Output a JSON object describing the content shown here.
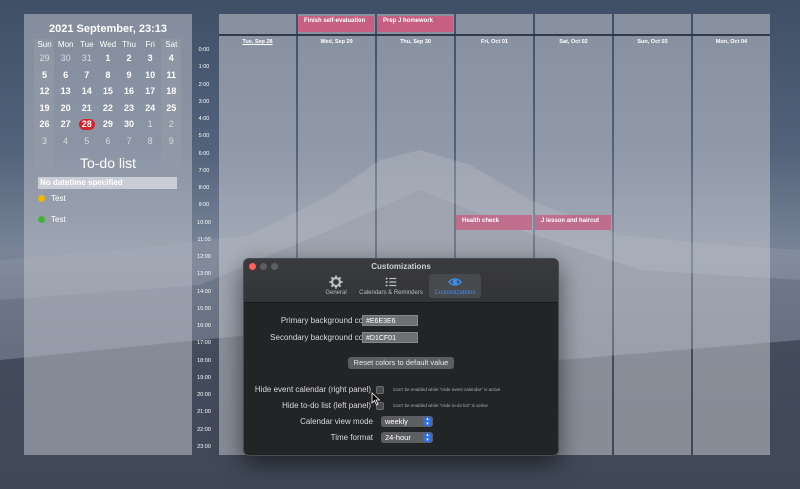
{
  "calendar": {
    "title": "2021 September, 23:13",
    "weekdays": [
      "Sun",
      "Mon",
      "Tue",
      "Wed",
      "Thu",
      "Fri",
      "Sat"
    ],
    "weeks": [
      [
        [
          "29",
          true
        ],
        [
          "30",
          true
        ],
        [
          "31",
          true
        ],
        [
          "1",
          false
        ],
        [
          "2",
          false
        ],
        [
          "3",
          false
        ],
        [
          "4",
          false
        ]
      ],
      [
        [
          "5",
          false
        ],
        [
          "6",
          false
        ],
        [
          "7",
          false
        ],
        [
          "8",
          false
        ],
        [
          "9",
          false
        ],
        [
          "10",
          false
        ],
        [
          "11",
          false
        ]
      ],
      [
        [
          "12",
          false
        ],
        [
          "13",
          false
        ],
        [
          "14",
          false
        ],
        [
          "15",
          false
        ],
        [
          "16",
          false
        ],
        [
          "17",
          false
        ],
        [
          "18",
          false
        ]
      ],
      [
        [
          "19",
          false
        ],
        [
          "20",
          false
        ],
        [
          "21",
          false
        ],
        [
          "22",
          false
        ],
        [
          "23",
          false
        ],
        [
          "24",
          false
        ],
        [
          "25",
          false
        ]
      ],
      [
        [
          "26",
          false
        ],
        [
          "27",
          false
        ],
        [
          "28",
          false
        ],
        [
          "29",
          false
        ],
        [
          "30",
          false
        ],
        [
          "1",
          true
        ],
        [
          "2",
          true
        ]
      ],
      [
        [
          "3",
          true
        ],
        [
          "4",
          true
        ],
        [
          "5",
          true
        ],
        [
          "6",
          true
        ],
        [
          "7",
          true
        ],
        [
          "8",
          true
        ],
        [
          "9",
          true
        ]
      ]
    ],
    "today": "28"
  },
  "todo": {
    "title": "To-do list",
    "section_header": "No datetime specified",
    "items": [
      {
        "label": "Test",
        "color": "#f2b600"
      },
      {
        "label": "Test",
        "color": "#44b23a"
      }
    ]
  },
  "schedule": {
    "hours": [
      "0:00",
      "1:00",
      "2:00",
      "3:00",
      "4:00",
      "5:00",
      "6:00",
      "7:00",
      "8:00",
      "9:00",
      "10:00",
      "11:00",
      "12:00",
      "13:00",
      "14:00",
      "15:00",
      "16:00",
      "17:00",
      "18:00",
      "19:00",
      "20:00",
      "21:00",
      "22:00",
      "23:00"
    ],
    "days": [
      {
        "label": "Tue, Sep 28",
        "current": true
      },
      {
        "label": "Wed, Sep 29",
        "current": false
      },
      {
        "label": "Thu, Sep 30",
        "current": false
      },
      {
        "label": "Fri, Oct 01",
        "current": false
      },
      {
        "label": "Sat, Oct 02",
        "current": false
      },
      {
        "label": "Sun, Oct 03",
        "current": false
      },
      {
        "label": "Mon, Oct 04",
        "current": false
      }
    ],
    "allday_events": [
      {
        "day": 1,
        "title": "Finish self-evaluation"
      },
      {
        "day": 2,
        "title": "Prep J homework"
      }
    ],
    "timed_events": [
      {
        "day": 3,
        "hour": 10,
        "title": "Health check"
      },
      {
        "day": 4,
        "hour": 10,
        "title": "J lesson and haircut"
      }
    ],
    "event_color": "#c65f82"
  },
  "dialog": {
    "title": "Customizations",
    "tabs": [
      {
        "label": "General",
        "icon": "gear-icon",
        "active": false
      },
      {
        "label": "Calendars & Reminders",
        "icon": "list-icon",
        "active": false
      },
      {
        "label": "Customizations",
        "icon": "eye-icon",
        "active": true
      }
    ],
    "primary_bg_label": "Primary background color",
    "primary_bg_value": "#E6E3E6",
    "secondary_bg_label": "Secondary background color",
    "secondary_bg_value": "#D1CF01",
    "reset_label": "Reset colors to default value",
    "hide_event_label": "Hide event calendar (right panel)",
    "hide_event_hint": "Can't be enabled while \"Hide event calendar\" is active",
    "hide_todo_label": "Hide to-do list (left panel)",
    "hide_todo_hint": "Can't be enabled while \"Hide to-do list\" is active",
    "view_mode_label": "Calendar view mode",
    "view_mode_value": "weekly",
    "time_format_label": "Time format",
    "time_format_value": "24-hour",
    "accent_color": "#3d8ef5"
  }
}
